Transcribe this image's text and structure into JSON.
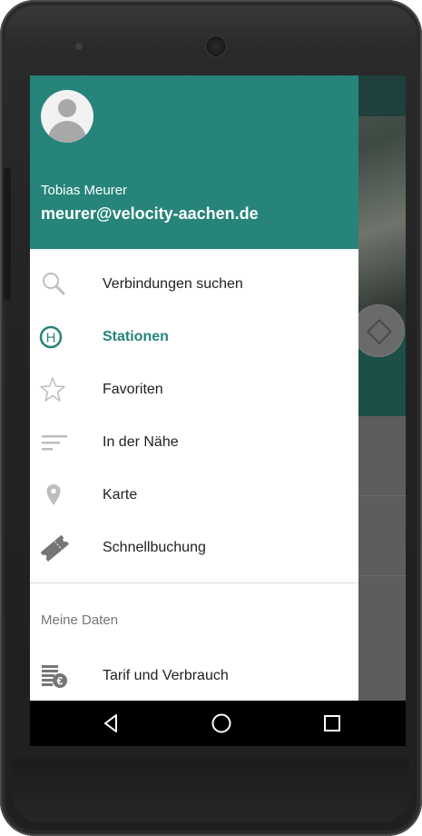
{
  "drawer": {
    "user_name": "Tobias Meurer",
    "user_email": "meurer@velocity-aachen.de",
    "items": [
      {
        "label": "Verbindungen suchen",
        "icon": "search-icon",
        "active": false
      },
      {
        "label": "Stationen",
        "icon": "station-h-icon",
        "active": true
      },
      {
        "label": "Favoriten",
        "icon": "star-icon",
        "active": false
      },
      {
        "label": "In der Nähe",
        "icon": "sort-lines-icon",
        "active": false
      },
      {
        "label": "Karte",
        "icon": "map-pin-icon",
        "active": false
      },
      {
        "label": "Schnellbuchung",
        "icon": "ticket-icon",
        "active": false
      }
    ],
    "section_title": "Meine Daten",
    "section_items": [
      {
        "label": "Tarif und Verbrauch",
        "icon": "euro-coins-icon"
      }
    ]
  },
  "colors": {
    "primary": "#26847a",
    "icon_grey": "#bdbdbd",
    "text": "#212121",
    "secondary_text": "#757575"
  },
  "navigation_bar": {
    "buttons": [
      "back-icon",
      "home-icon",
      "recents-icon"
    ]
  }
}
